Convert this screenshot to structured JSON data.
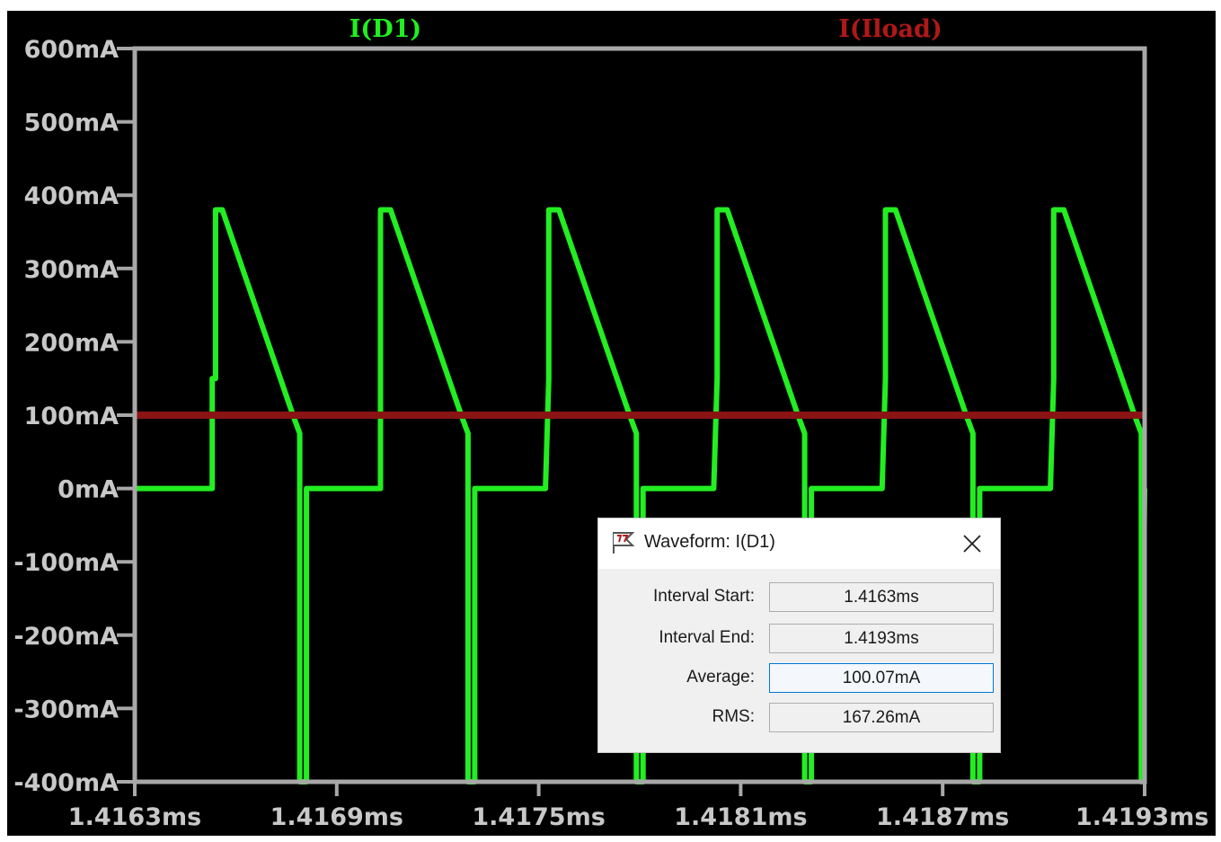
{
  "chart_data": {
    "type": "line",
    "title": "",
    "xlabel": "",
    "ylabel": "",
    "xlim": [
      1.4163,
      1.4193
    ],
    "ylim": [
      -400,
      600
    ],
    "x_unit": "ms",
    "y_unit": "mA",
    "x_ticks": [
      "1.4163ms",
      "1.4169ms",
      "1.4175ms",
      "1.4181ms",
      "1.4187ms",
      "1.4193ms"
    ],
    "y_ticks": [
      "600mA",
      "500mA",
      "400mA",
      "300mA",
      "200mA",
      "100mA",
      "0mA",
      "-100mA",
      "-200mA",
      "-300mA",
      "-400mA"
    ],
    "grid": false,
    "legend_position": "top",
    "series": [
      {
        "name": "I(D1)",
        "color": "#22ee22",
        "x": [
          1.4163,
          1.41653,
          1.41653,
          1.41654,
          1.41654,
          1.41656,
          1.41677,
          1.41679,
          1.41679,
          1.41681,
          1.41681,
          1.41703,
          1.41703,
          1.41703,
          1.41703,
          1.41706,
          1.41727,
          1.41729,
          1.41729,
          1.41731,
          1.41731,
          1.41752,
          1.41752,
          1.41753,
          1.41753,
          1.41756,
          1.41777,
          1.41779,
          1.41779,
          1.41781,
          1.41781,
          1.41802,
          1.41802,
          1.41803,
          1.41803,
          1.41806,
          1.41827,
          1.41829,
          1.41829,
          1.41831,
          1.41831,
          1.41852,
          1.41852,
          1.41853,
          1.41853,
          1.41856,
          1.41877,
          1.41879,
          1.41879,
          1.41881,
          1.41881,
          1.41902,
          1.41902,
          1.41903,
          1.41903,
          1.41906,
          1.41927,
          1.41929,
          1.41929,
          1.4193
        ],
        "y": [
          0,
          0,
          150,
          150,
          380,
          380,
          100,
          75,
          -400,
          -400,
          0,
          0,
          0,
          150,
          380,
          380,
          100,
          75,
          -400,
          -400,
          0,
          0,
          0,
          150,
          380,
          380,
          100,
          75,
          -400,
          -400,
          0,
          0,
          0,
          150,
          380,
          380,
          100,
          75,
          -400,
          -400,
          0,
          0,
          0,
          150,
          380,
          380,
          100,
          75,
          -400,
          -400,
          0,
          0,
          0,
          150,
          380,
          380,
          100,
          75,
          -400,
          0
        ]
      },
      {
        "name": "I(Iload)",
        "color": "#8a1414",
        "x": [
          1.4163,
          1.4193
        ],
        "y": [
          100,
          100
        ]
      }
    ]
  },
  "dialog": {
    "title": "Waveform: I(D1)",
    "icon": "ltspice-app-icon",
    "close_icon": "close-icon",
    "fields": [
      {
        "label": "Interval Start:",
        "value": "1.4163ms",
        "focused": false
      },
      {
        "label": "Interval End:",
        "value": "1.4193ms",
        "focused": false
      },
      {
        "label": "Average:",
        "value": "100.07mA",
        "focused": true
      },
      {
        "label": "RMS:",
        "value": "167.26mA",
        "focused": false
      }
    ]
  }
}
